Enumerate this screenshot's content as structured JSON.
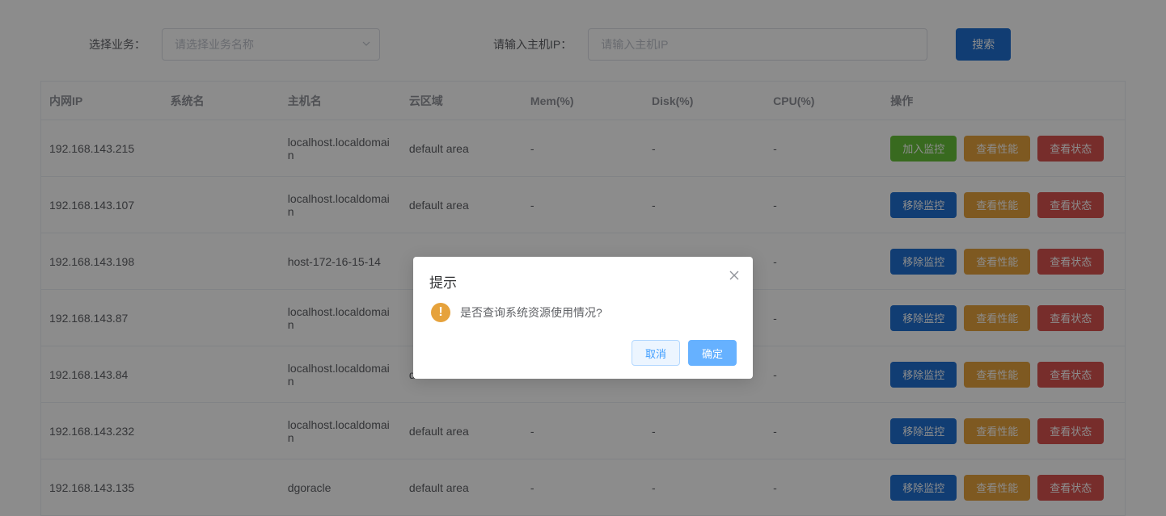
{
  "filters": {
    "business_label": "选择业务：",
    "business_placeholder": "请选择业务名称",
    "host_ip_label": "请输入主机IP：",
    "host_ip_placeholder": "请输入主机IP",
    "search_button": "搜索"
  },
  "table": {
    "headers": {
      "ip": "内网IP",
      "sys": "系统名",
      "host": "主机名",
      "zone": "云区域",
      "mem": "Mem(%)",
      "disk": "Disk(%)",
      "cpu": "CPU(%)",
      "ops": "操作"
    },
    "ops_labels": {
      "add_monitor": "加入监控",
      "remove_monitor": "移除监控",
      "view_perf": "查看性能",
      "view_status": "查看状态"
    },
    "rows": [
      {
        "ip": "192.168.143.215",
        "sys": "",
        "host": "localhost.localdomain",
        "zone": "default area",
        "mem": "-",
        "disk": "-",
        "cpu": "-",
        "first_op": "add"
      },
      {
        "ip": "192.168.143.107",
        "sys": "",
        "host": "localhost.localdomain",
        "zone": "default area",
        "mem": "-",
        "disk": "-",
        "cpu": "-",
        "first_op": "remove"
      },
      {
        "ip": "192.168.143.198",
        "sys": "",
        "host": "host-172-16-15-14",
        "zone": "",
        "mem": "-",
        "disk": "-",
        "cpu": "-",
        "first_op": "remove"
      },
      {
        "ip": "192.168.143.87",
        "sys": "",
        "host": "localhost.localdomain",
        "zone": "",
        "mem": "-",
        "disk": "-",
        "cpu": "-",
        "first_op": "remove"
      },
      {
        "ip": "192.168.143.84",
        "sys": "",
        "host": "localhost.localdomain",
        "zone": "default area",
        "mem": "-",
        "disk": "-",
        "cpu": "-",
        "first_op": "remove"
      },
      {
        "ip": "192.168.143.232",
        "sys": "",
        "host": "localhost.localdomain",
        "zone": "default area",
        "mem": "-",
        "disk": "-",
        "cpu": "-",
        "first_op": "remove"
      },
      {
        "ip": "192.168.143.135",
        "sys": "",
        "host": "dgoracle",
        "zone": "default area",
        "mem": "-",
        "disk": "-",
        "cpu": "-",
        "first_op": "remove"
      }
    ]
  },
  "dialog": {
    "title": "提示",
    "message": "是否查询系统资源使用情况?",
    "cancel": "取消",
    "ok": "确定"
  }
}
